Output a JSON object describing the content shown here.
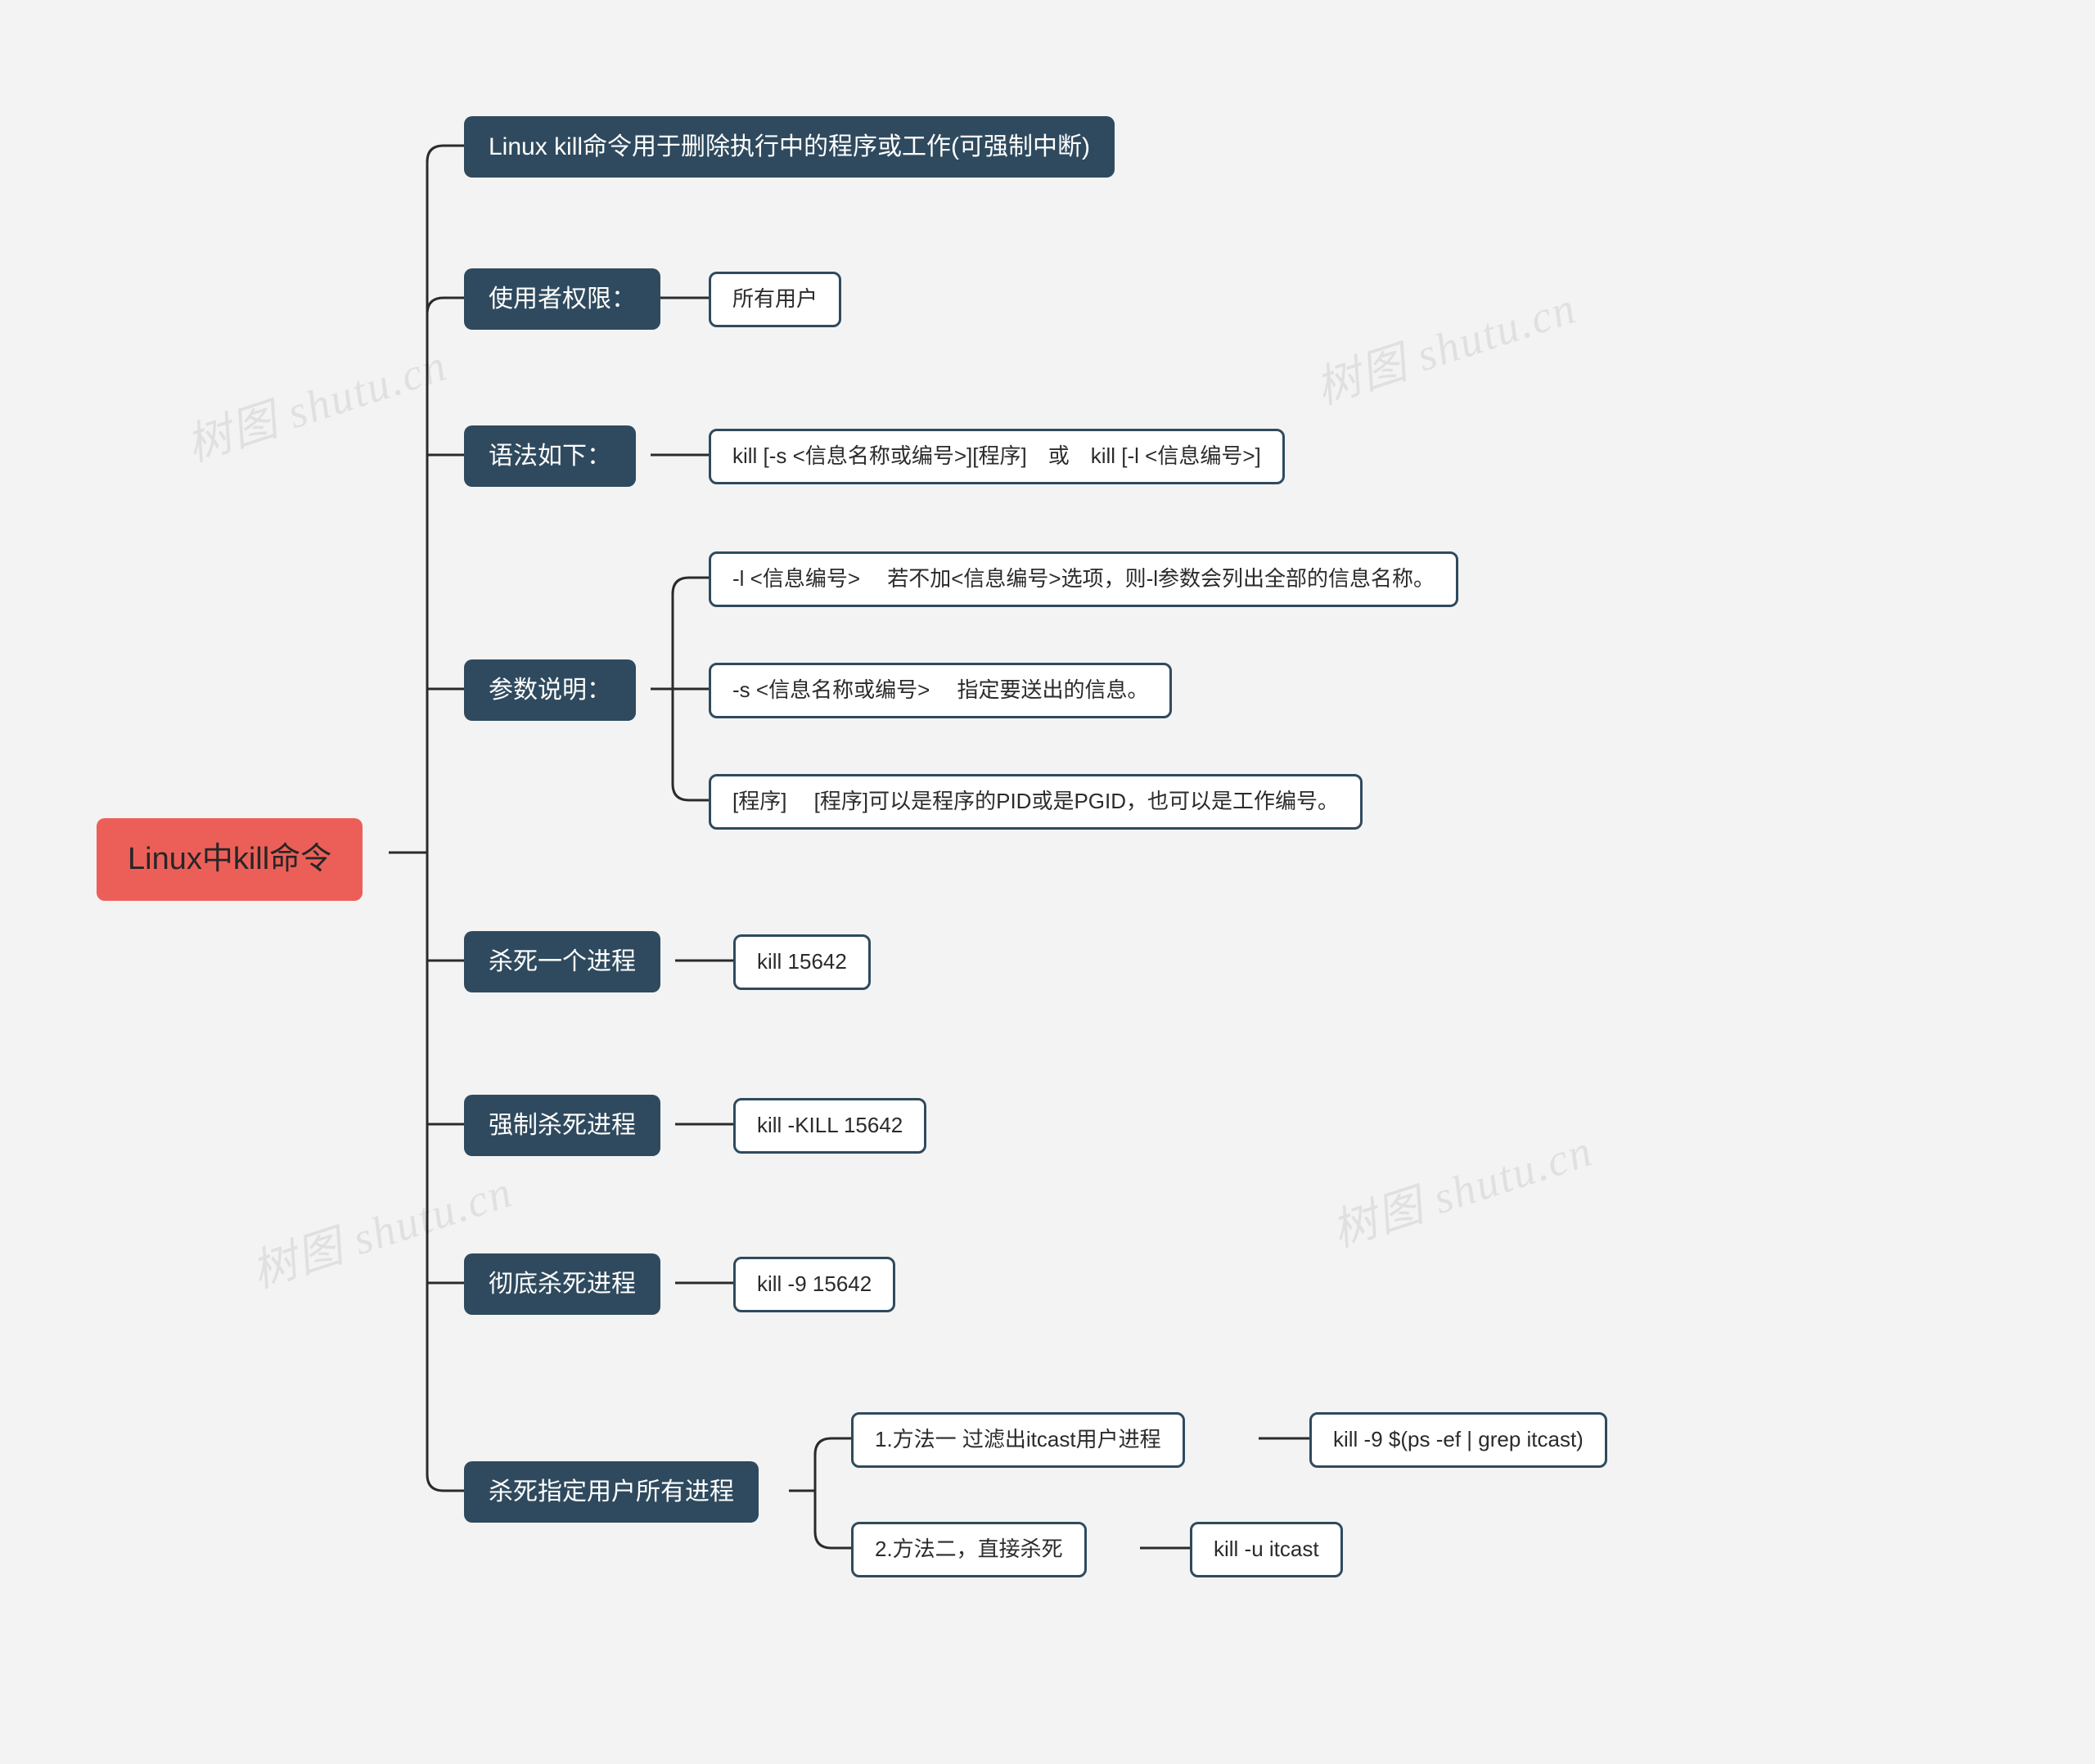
{
  "root": "Linux中kill命令",
  "branches": {
    "desc": "Linux kill命令用于删除执行中的程序或工作(可强制中断)",
    "perm": "使用者权限：",
    "perm_val": "所有用户",
    "syntax": "语法如下：",
    "syntax_val": "kill [-s <信息名称或编号>][程序]　或　kill [-l <信息编号>]",
    "params": "参数说明：",
    "param_l": "-l <信息编号> 　若不加<信息编号>选项，则-l参数会列出全部的信息名称。",
    "param_s": "-s <信息名称或编号> 　指定要送出的信息。",
    "param_prog": "[程序] 　[程序]可以是程序的PID或是PGID，也可以是工作编号。",
    "kill_one": "杀死一个进程",
    "kill_one_val": "kill 15642",
    "force": "强制杀死进程",
    "force_val": "kill -KILL 15642",
    "hard": "彻底杀死进程",
    "hard_val": "kill -9 15642",
    "user": "杀死指定用户所有进程",
    "user_m1": "1.方法一 过滤出itcast用户进程",
    "user_m1_val": "kill -9 $(ps -ef | grep itcast)",
    "user_m2": "2.方法二，直接杀死",
    "user_m2_val": "kill -u itcast"
  },
  "watermark": "树图 shutu.cn"
}
